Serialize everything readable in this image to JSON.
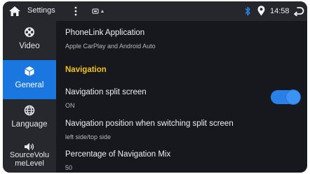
{
  "statusbar": {
    "title": "Settings",
    "time": "14:58"
  },
  "sidebar": {
    "items": [
      {
        "label": "Video",
        "icon": "film-reel-icon"
      },
      {
        "label": "General",
        "icon": "cube-icon",
        "active": true
      },
      {
        "label": "Language",
        "icon": "globe-icon"
      },
      {
        "label": "SourceVolumeLevel",
        "label_lines": [
          "SourceVolu",
          "meLevel"
        ],
        "icon": "speaker-icon"
      }
    ]
  },
  "content": {
    "phonelink": {
      "title": "PhoneLink Application",
      "subtitle": "Apple CarPlay and Android Auto"
    },
    "section_heading": "Navigation",
    "split_screen": {
      "title": "Navigation split screen",
      "value": "ON",
      "toggle_on": true
    },
    "split_position": {
      "title": "Navigation position when switching split screen",
      "value": "left side/top side"
    },
    "nav_mix": {
      "title": "Percentage of Navigation Mix",
      "value": "50"
    }
  },
  "colors": {
    "accent": "#1b77e0",
    "section_heading": "#f2c21a",
    "background": "#17181d",
    "sidebar": "#27282e"
  }
}
